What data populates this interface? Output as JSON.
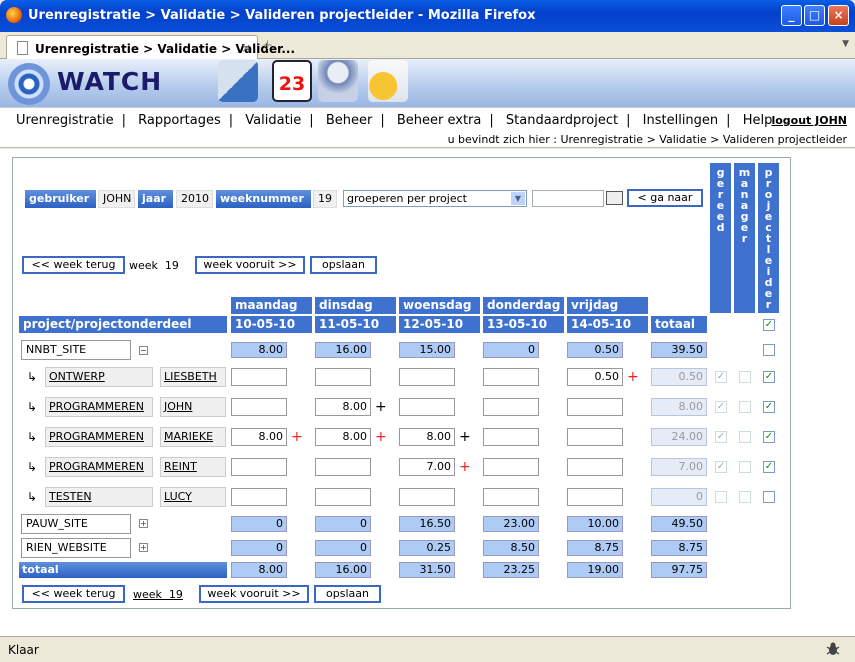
{
  "window": {
    "title": "Urenregistratie > Validatie > Valideren projectleider - Mozilla Firefox",
    "tab_title": "Urenregistratie > Validatie > Valider...",
    "minimize": "_",
    "maximize": "□",
    "close": "×"
  },
  "app": {
    "logo": "WATCH",
    "calendar_day": "23",
    "toolbar_icons": [
      "calendar-clock-icon",
      "calendar-icon",
      "people-icon",
      "money-document-icon"
    ]
  },
  "nav": {
    "items": [
      "Urenregistratie",
      "Rapportages",
      "Validatie",
      "Beheer",
      "Beheer extra",
      "Standaardproject",
      "Instellingen",
      "Help"
    ],
    "separator": "|",
    "logout": "logout JOHN"
  },
  "breadcrumb": "u bevindt zich hier : Urenregistratie > Validatie > Valideren projectleider",
  "filters": {
    "gebruiker_label": "gebruiker",
    "gebruiker_value": "JOHN",
    "jaar_label": "jaar",
    "jaar_value": "2010",
    "weeknummer_label": "weeknummer",
    "weeknummer_value": "19",
    "group_select": "groeperen per project",
    "goto_input": "",
    "goto_button": "< ga naar"
  },
  "vertical_headers": {
    "gereed": "g\ne\nr\ne\ne\nd",
    "manager": "m\na\nn\na\ng\ne\nr",
    "projectleider": "p\nr\no\nj\ne\nc\nt\nl\ne\ni\nd\ne\nr"
  },
  "week_nav": {
    "back": "<< week terug",
    "week_label": "week  19",
    "week_link": "week  19",
    "forward": "week vooruit >>",
    "save": "opslaan"
  },
  "table": {
    "project_header": "project/projectonderdeel",
    "days": [
      "maandag",
      "dinsdag",
      "woensdag",
      "donderdag",
      "vrijdag"
    ],
    "dates": [
      "10-05-10",
      "11-05-10",
      "12-05-10",
      "13-05-10",
      "14-05-10"
    ],
    "total_header": "totaal",
    "projects": [
      {
        "name": "NNBT_SITE",
        "toggle": "−",
        "values": [
          "8.00",
          "16.00",
          "15.00",
          "0",
          "0.50"
        ],
        "total": "39.50"
      },
      {
        "name": "PAUW_SITE",
        "toggle": "+",
        "values": [
          "0",
          "0",
          "16.50",
          "23.00",
          "10.00"
        ],
        "total": "49.50"
      },
      {
        "name": "RIEN_WEBSITE",
        "toggle": "+",
        "values": [
          "0",
          "0",
          "0.25",
          "8.50",
          "8.75"
        ],
        "total": "8.75"
      }
    ],
    "sub_rows": [
      {
        "part": "ONTWERP",
        "user": "LIESBETH",
        "values": [
          "",
          "",
          "",
          "",
          "0.50"
        ],
        "total": "0.50"
      },
      {
        "part": "PROGRAMMEREN",
        "user": "JOHN",
        "values": [
          "",
          "8.00",
          "",
          "",
          ""
        ],
        "total": "8.00"
      },
      {
        "part": "PROGRAMMEREN",
        "user": "MARIEKE",
        "values": [
          "8.00",
          "8.00",
          "8.00",
          "",
          ""
        ],
        "total": "24.00"
      },
      {
        "part": "PROGRAMMEREN",
        "user": "REINT",
        "values": [
          "",
          "",
          "7.00",
          "",
          ""
        ],
        "total": "7.00"
      },
      {
        "part": "TESTEN",
        "user": "LUCY",
        "values": [
          "",
          "",
          "",
          "",
          ""
        ],
        "total": "0"
      }
    ],
    "totals_label": "totaal",
    "totals": [
      "8.00",
      "16.00",
      "31.50",
      "23.25",
      "19.00"
    ],
    "grand_total": "97.75",
    "plus_sign": "+",
    "check_mark": "✓",
    "sub_arrow": "↳"
  },
  "status": {
    "text": "Klaar"
  }
}
